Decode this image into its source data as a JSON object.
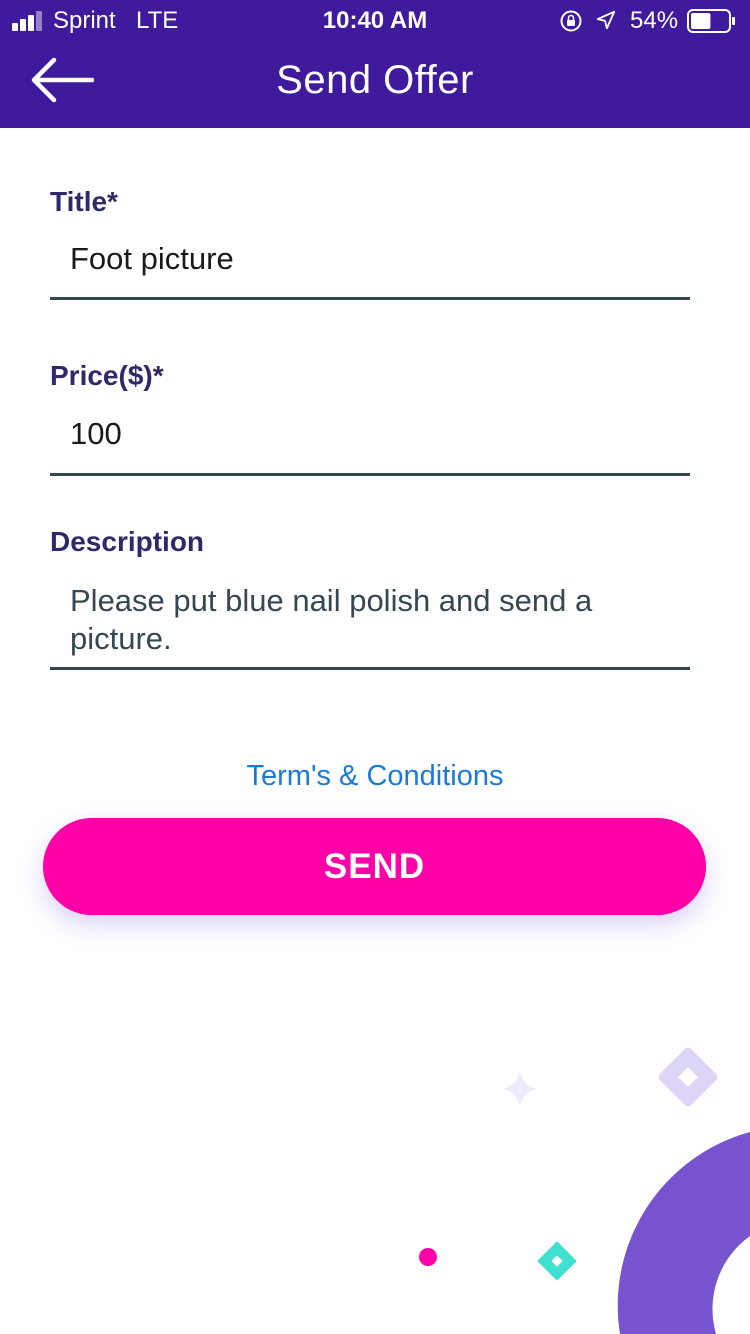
{
  "status_bar": {
    "carrier": "Sprint",
    "network": "LTE",
    "time": "10:40 AM",
    "battery_percent": "54%",
    "battery_level": 0.54
  },
  "nav": {
    "back_icon": "arrow-left-icon",
    "title": "Send Offer"
  },
  "form": {
    "title": {
      "label": "Title*",
      "value": "Foot picture"
    },
    "price": {
      "label": "Price($)*",
      "value": "100"
    },
    "description": {
      "label": "Description",
      "value": "Please put blue nail polish and send a picture."
    }
  },
  "terms_link": "Term's & Conditions",
  "send_button": "SEND",
  "colors": {
    "header": "#3f1a9c",
    "label": "#2e2a6a",
    "link": "#1a7ad6",
    "send_button": "#ff00a8",
    "deco_purple": "#7853d0",
    "deco_lavender": "#ddd5f5",
    "deco_teal": "#3fe0cf"
  }
}
